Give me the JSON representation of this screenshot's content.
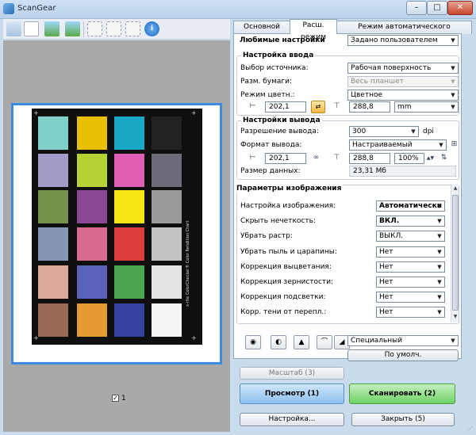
{
  "window": {
    "title": "ScanGear",
    "minimize": "–",
    "maximize": "□",
    "close": "✕"
  },
  "tabs": [
    {
      "label": "Основной режим"
    },
    {
      "label": "Расш. режим"
    },
    {
      "label": "Режим автоматического сканирования"
    }
  ],
  "favorites": {
    "label": "Любимые настройки",
    "value": "Задано пользователем"
  },
  "input_settings": {
    "title": "Настройка ввода",
    "source_label": "Выбор источника:",
    "source_value": "Рабочая поверхность",
    "paper_label": "Разм. бумаги:",
    "paper_value": "Весь планшет",
    "color_label": "Режим цветн.:",
    "color_value": "Цветное",
    "width": "202,1",
    "height": "288,8",
    "unit": "mm"
  },
  "output_settings": {
    "title": "Настройки вывода",
    "resolution_label": "Разрешение вывода:",
    "resolution_value": "300",
    "resolution_unit": "dpi",
    "format_label": "Формат вывода:",
    "format_value": "Настраиваемый",
    "width": "202,1",
    "height": "288,8",
    "scale": "100%",
    "data_size_label": "Размер данных:",
    "data_size_value": "23,31 Мб"
  },
  "image_settings": {
    "title": "Параметры изображения",
    "rows": [
      {
        "label": "Настройка изображения:",
        "value": "Автоматически",
        "bold": true
      },
      {
        "label": "Скрыть нечеткость:",
        "value": "ВКЛ.",
        "bold": true
      },
      {
        "label": "Убрать растр:",
        "value": "ВЫКЛ.",
        "bold": false
      },
      {
        "label": "Убрать пыль и царапины:",
        "value": "Нет",
        "bold": false
      },
      {
        "label": "Коррекция выцветания:",
        "value": "Нет",
        "bold": false
      },
      {
        "label": "Коррекция зернистости:",
        "value": "Нет",
        "bold": false
      },
      {
        "label": "Коррекция подсветки:",
        "value": "Нет",
        "bold": false
      },
      {
        "label": "Корр. тени от перепл.:",
        "value": "Нет",
        "bold": false
      }
    ]
  },
  "color_tools": {
    "preset_value": "Специальный",
    "default_button": "По умолч."
  },
  "buttons": {
    "zoom": "Масштаб (3)",
    "preview": "Просмотр (1)",
    "scan": "Сканировать (2)",
    "settings": "Настройка...",
    "close": "Закрыть (5)"
  },
  "preview": {
    "frame_number": "1",
    "target_label": "x-rite ColorChecker® Color Rendition Chart",
    "patch_colors": [
      [
        "#7fd2cc",
        "#e6c000",
        "#18a8c6",
        "#222222"
      ],
      [
        "#a49bc8",
        "#b5d335",
        "#e05fb5",
        "#6d6b77"
      ],
      [
        "#76934b",
        "#8d4797",
        "#f4e614",
        "#9a9a9a"
      ],
      [
        "#8396b6",
        "#d86a8d",
        "#d93d3d",
        "#c4c4c4"
      ],
      [
        "#dcaa9a",
        "#5a63b8",
        "#4aa650",
        "#e4e4e4"
      ],
      [
        "#976a58",
        "#e89a32",
        "#3642a0",
        "#f5f5f5"
      ]
    ]
  },
  "colors": {
    "accent": "#3a8ae0",
    "preview_green": "#6fd265",
    "preview_blue": "#8cc0ee"
  }
}
